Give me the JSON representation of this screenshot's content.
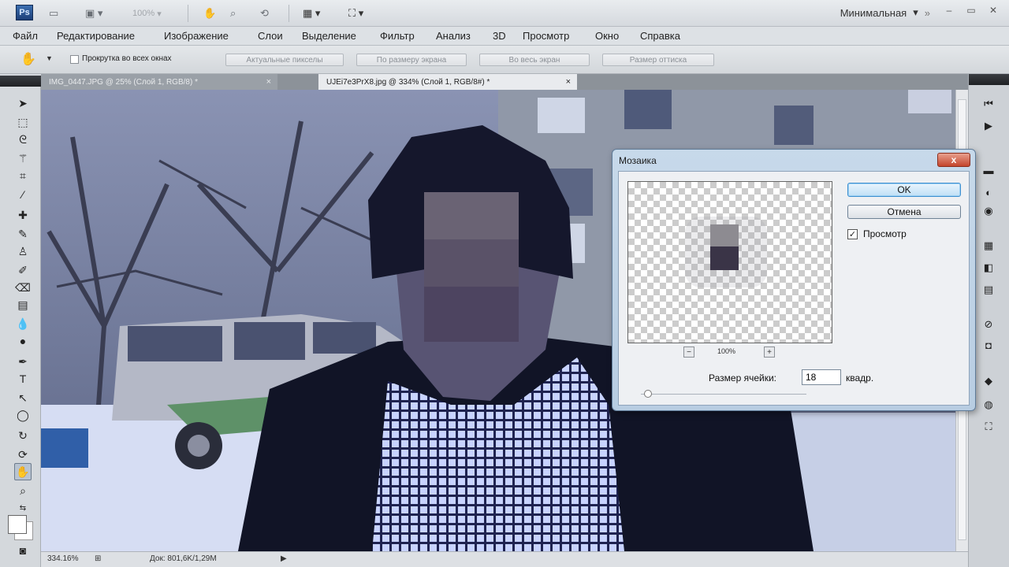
{
  "appbar": {
    "logo": "Ps",
    "zoom": "100%",
    "workspace": "Минимальная"
  },
  "menu": [
    "Файл",
    "Редактирование",
    "Изображение",
    "Слои",
    "Выделение",
    "Фильтр",
    "Анализ",
    "3D",
    "Просмотр",
    "Окно",
    "Справка"
  ],
  "options": {
    "scroll_all_label": "Прокрутка во всех окнах",
    "actual_pixels": "Актуальные пикселы",
    "fit_screen": "По размеру экрана",
    "fill_screen": "Во весь экран",
    "print_size": "Размер оттиска"
  },
  "tabs": {
    "inactive": "IMG_0447.JPG @ 25% (Слой 1, RGB/8) *",
    "active": "UJEi7e3PrX8.jpg @ 334% (Слой 1, RGB/8#) *",
    "close": "×"
  },
  "status": {
    "zoom": "334.16%",
    "doc": "Док: 801,6K/1,29M"
  },
  "dialog": {
    "title": "Мозаика",
    "close": "x",
    "ok": "OK",
    "cancel": "Отмена",
    "preview_label": "Просмотр",
    "preview_checked": true,
    "zoom_minus": "−",
    "zoom_value": "100%",
    "zoom_plus": "+",
    "cell_size_label": "Размер ячейки:",
    "cell_size_value": "18",
    "cell_size_unit": "квадр."
  }
}
